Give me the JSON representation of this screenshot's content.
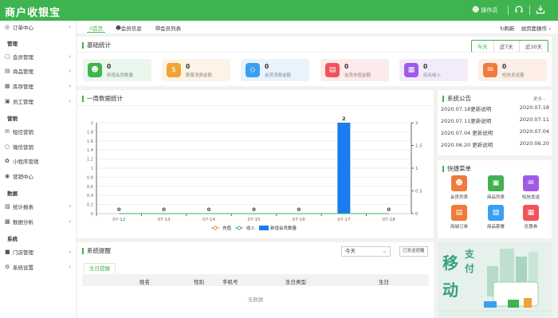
{
  "app": {
    "title": "商户收银宝"
  },
  "topbar": {
    "operator_label": "操作员"
  },
  "sidebar": {
    "items": [
      {
        "label": "订单中心",
        "icon": "globe-icon"
      },
      {
        "group": "管理"
      },
      {
        "label": "会员管理",
        "icon": "member-icon"
      },
      {
        "label": "商品管理",
        "icon": "product-icon"
      },
      {
        "label": "库存管理",
        "icon": "inventory-icon"
      },
      {
        "label": "员工管理",
        "icon": "staff-icon"
      },
      {
        "group": "营销"
      },
      {
        "label": "短信营销",
        "icon": "sms-icon"
      },
      {
        "label": "微信营销",
        "icon": "wechat-icon"
      },
      {
        "label": "小程序营销",
        "icon": "mini-program-icon"
      },
      {
        "label": "营销中心",
        "icon": "marketing-icon"
      },
      {
        "group": "数据"
      },
      {
        "label": "统计报表",
        "icon": "report-icon"
      },
      {
        "label": "数据分析",
        "icon": "analysis-icon"
      },
      {
        "group": "系统"
      },
      {
        "label": "门店管理",
        "icon": "store-icon"
      },
      {
        "label": "系统设置",
        "icon": "settings-icon"
      }
    ]
  },
  "tabs": [
    {
      "label": "首页"
    },
    {
      "label": "会员信息"
    },
    {
      "label": "会员列表"
    }
  ],
  "tab_actions": {
    "refresh": "刷新",
    "page_ops": "页面操作"
  },
  "basic_stats": {
    "title": "基础统计",
    "ranges": [
      "今天",
      "近7天",
      "近30天"
    ],
    "cards": [
      {
        "value": "0",
        "label": "新增会员数量",
        "color": "#3fb34f",
        "bg": "#eaf7ec",
        "icon": "user-icon"
      },
      {
        "value": "0",
        "label": "散客消费金额",
        "color": "#f0a431",
        "bg": "#fdf3e6",
        "icon": "dollar-icon"
      },
      {
        "value": "0",
        "label": "会员消费金额",
        "color": "#3a9ff0",
        "bg": "#e8f3fd",
        "icon": "diamond-icon"
      },
      {
        "value": "0",
        "label": "会员充值金额",
        "color": "#f0545a",
        "bg": "#fdeaea",
        "icon": "card-icon"
      },
      {
        "value": "0",
        "label": "综合收入",
        "color": "#a05ae8",
        "bg": "#f3eafc",
        "icon": "wallet-icon"
      },
      {
        "value": "0",
        "label": "短信发送量",
        "color": "#f07a3a",
        "bg": "#fdeee6",
        "icon": "envelope-icon"
      }
    ]
  },
  "weekly": {
    "title": "一周数据统计"
  },
  "chart_data": {
    "type": "bar",
    "categories": [
      "07-12",
      "07-13",
      "07-14",
      "07-15",
      "07-16",
      "07-17",
      "07-18"
    ],
    "series": [
      {
        "name": "充值",
        "type": "line",
        "values": [
          0,
          0,
          0,
          0,
          0,
          0,
          0
        ],
        "color": "#f07a3a"
      },
      {
        "name": "收入",
        "type": "line",
        "values": [
          0,
          0,
          0,
          0,
          0,
          0,
          0
        ],
        "color": "#3fb34f"
      },
      {
        "name": "新增会员数量",
        "type": "bar",
        "values": [
          0,
          0,
          0,
          0,
          0,
          2,
          0
        ],
        "color": "#1a7cf0"
      }
    ],
    "ylim": [
      0,
      2
    ],
    "y_left_ticks": [
      "0",
      "0.2",
      "0.4",
      "0.6",
      "0.8",
      "1",
      "1.2",
      "1.4",
      "1.6",
      "1.8",
      "2"
    ],
    "y_right_ticks": [
      "0",
      "0.5",
      "1",
      "1.5",
      "2"
    ],
    "legend_position": "bottom"
  },
  "notice": {
    "title": "系统公告",
    "more": "更多",
    "rows": [
      {
        "text": "2020.07.18更新说明",
        "date": "2020.07.18"
      },
      {
        "text": "2020.07.11更新说明",
        "date": "2020.07.11"
      },
      {
        "text": "2020.07.04 更新说明",
        "date": "2020.07.04"
      },
      {
        "text": "2020.06.20 更新说明",
        "date": "2020.06.20"
      }
    ]
  },
  "quick_menu": {
    "title": "快捷菜单",
    "items": [
      {
        "label": "会员列表",
        "color": "#f07a3a",
        "icon": "member-list-icon"
      },
      {
        "label": "商品列表",
        "color": "#3fb34f",
        "icon": "bag-icon"
      },
      {
        "label": "短信发送",
        "color": "#a05ae8",
        "icon": "mail-icon"
      },
      {
        "label": "商城订单",
        "color": "#f07a3a",
        "icon": "order-icon"
      },
      {
        "label": "商品套餐",
        "color": "#3a9ff0",
        "icon": "basket-icon"
      },
      {
        "label": "优惠券",
        "color": "#f0545a",
        "icon": "coupon-icon"
      }
    ]
  },
  "reminder": {
    "title": "系统提醒",
    "select_value": "今天",
    "button": "已发送提醒",
    "subtab": "生日提醒",
    "columns": [
      "姓名",
      "性别",
      "手机号",
      "生日类型",
      "生日"
    ],
    "empty": "无数据"
  },
  "banner": {
    "big1": "移",
    "big2": "动",
    "small1": "支",
    "small2": "付"
  }
}
